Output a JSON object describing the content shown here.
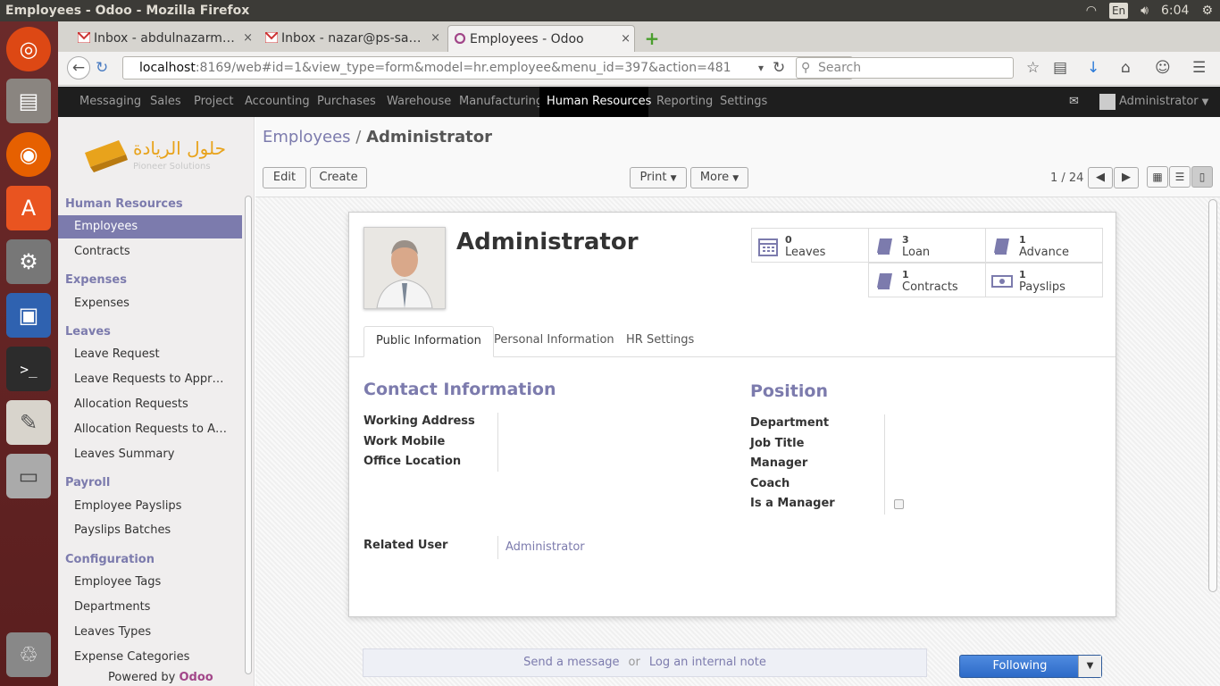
{
  "os": {
    "window_title": "Employees - Odoo - Mozilla Firefox",
    "lang": "En",
    "clock": "6:04"
  },
  "browser": {
    "tabs": [
      {
        "label": "Inbox - abdulnazarm…",
        "close": "×"
      },
      {
        "label": "Inbox - nazar@ps-sa…",
        "close": "×"
      },
      {
        "label": "Employees - Odoo",
        "close": "×"
      }
    ],
    "new_tab": "+",
    "url_host": "localhost",
    "url_rest": ":8169/web#id=1&view_type=form&model=hr.employee&menu_id=397&action=481",
    "search_placeholder": "Search"
  },
  "topnav": {
    "menus": [
      "Messaging",
      "Sales",
      "Project",
      "Accounting",
      "Purchases",
      "Warehouse",
      "Manufacturing",
      "Human Resources",
      "Reporting",
      "Settings"
    ],
    "user": "Administrator"
  },
  "sidebar": {
    "logo_arabic": "حلول الريادة",
    "logo_english": "Pioneer Solutions",
    "sections": [
      {
        "title": "Human Resources",
        "items": [
          "Employees",
          "Contracts"
        ]
      },
      {
        "title": "Expenses",
        "items": [
          "Expenses"
        ]
      },
      {
        "title": "Leaves",
        "items": [
          "Leave Request",
          "Leave Requests to Appr…",
          "Allocation Requests",
          "Allocation Requests to A…",
          "Leaves Summary"
        ]
      },
      {
        "title": "Payroll",
        "items": [
          "Employee Payslips",
          "Payslips Batches"
        ]
      },
      {
        "title": "Configuration",
        "items": [
          "Employee Tags",
          "Departments",
          "Leaves Types",
          "Expense Categories"
        ]
      }
    ],
    "powered_by": "Powered by",
    "powered_brand": "Odoo"
  },
  "breadcrumb": {
    "parent": "Employees",
    "sep": "/",
    "current": "Administrator"
  },
  "buttons": {
    "edit": "Edit",
    "create": "Create",
    "print": "Print",
    "more": "More"
  },
  "pager": "1 / 24",
  "employee": {
    "name": "Administrator",
    "stats": [
      {
        "num": "0",
        "label": "Leaves",
        "icon": "calendar-icon"
      },
      {
        "num": "3",
        "label": "Loan",
        "icon": "book-icon"
      },
      {
        "num": "1",
        "label": "Advance",
        "icon": "book-icon"
      },
      {
        "num": "1",
        "label": "Contracts",
        "icon": "book-icon"
      },
      {
        "num": "1",
        "label": "Payslips",
        "icon": "money-icon"
      }
    ],
    "tabs": [
      "Public Information",
      "Personal Information",
      "HR Settings"
    ],
    "contact": {
      "title": "Contact Information",
      "labels": [
        "Working Address",
        "Work Mobile",
        "Office Location"
      ]
    },
    "position": {
      "title": "Position",
      "labels": [
        "Department",
        "Job Title",
        "Manager",
        "Coach",
        "Is a Manager"
      ]
    },
    "related_user_label": "Related User",
    "related_user_value": "Administrator"
  },
  "chatter": {
    "send": "Send a message",
    "or": "or",
    "log": "Log an internal note",
    "following": "Following"
  },
  "colors": {
    "accent": "#7c7bad",
    "topbar": "#1e1e1e",
    "launcher": "#5a1e1e"
  }
}
